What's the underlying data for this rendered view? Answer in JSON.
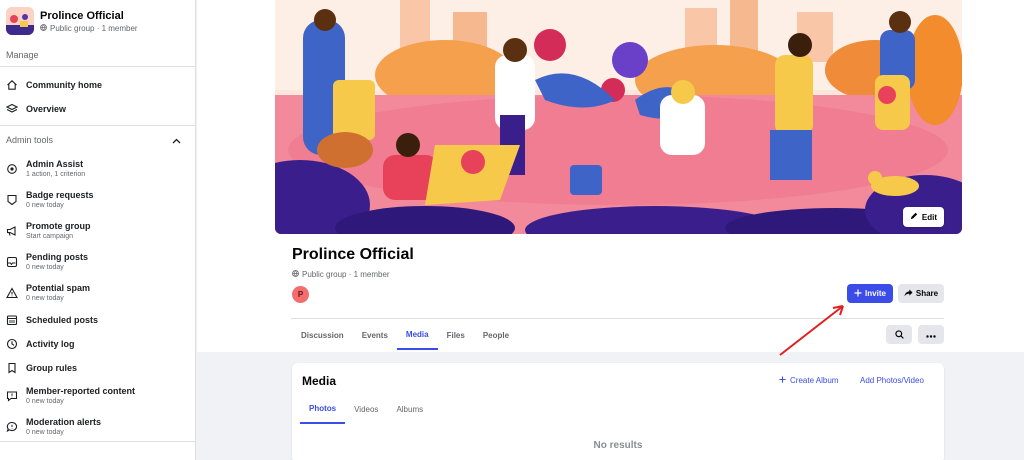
{
  "sidebar": {
    "group_name": "Prolince Official",
    "group_meta": "Public group · 1 member",
    "manage_label": "Manage",
    "items": [
      {
        "label": "Community home",
        "icon": "home-icon"
      },
      {
        "label": "Overview",
        "icon": "layers-icon"
      }
    ],
    "admin_tools_label": "Admin tools",
    "admin_items": [
      {
        "label": "Admin Assist",
        "sub": "1 action, 1 criterion",
        "icon": "gear-icon"
      },
      {
        "label": "Badge requests",
        "sub": "0 new today",
        "icon": "badge-icon"
      },
      {
        "label": "Promote group",
        "sub": "Start campaign",
        "icon": "megaphone-icon"
      },
      {
        "label": "Pending posts",
        "sub": "0 new today",
        "icon": "pending-icon"
      },
      {
        "label": "Potential spam",
        "sub": "0 new today",
        "icon": "warning-icon"
      },
      {
        "label": "Scheduled posts",
        "sub": "",
        "icon": "calendar-icon"
      },
      {
        "label": "Activity log",
        "sub": "",
        "icon": "clock-icon"
      },
      {
        "label": "Group rules",
        "sub": "",
        "icon": "rules-icon"
      },
      {
        "label": "Member-reported content",
        "sub": "0 new today",
        "icon": "report-icon"
      },
      {
        "label": "Moderation alerts",
        "sub": "0 new today",
        "icon": "alert-bubble-icon"
      }
    ]
  },
  "cover": {
    "edit_label": "Edit"
  },
  "group": {
    "title": "Prolince Official",
    "meta": "Public group · 1 member",
    "member_initial": "P",
    "invite_label": "Invite",
    "share_label": "Share"
  },
  "tabs": [
    {
      "label": "Discussion"
    },
    {
      "label": "Events"
    },
    {
      "label": "Media",
      "active": true
    },
    {
      "label": "Files"
    },
    {
      "label": "People"
    }
  ],
  "media": {
    "title": "Media",
    "create_album": "Create Album",
    "add_photos": "Add Photos/Video",
    "tabs": [
      "Photos",
      "Videos",
      "Albums"
    ],
    "no_results": "No results"
  },
  "colors": {
    "accent": "#3b4ce8",
    "annotation_arrow": "#e02020"
  }
}
